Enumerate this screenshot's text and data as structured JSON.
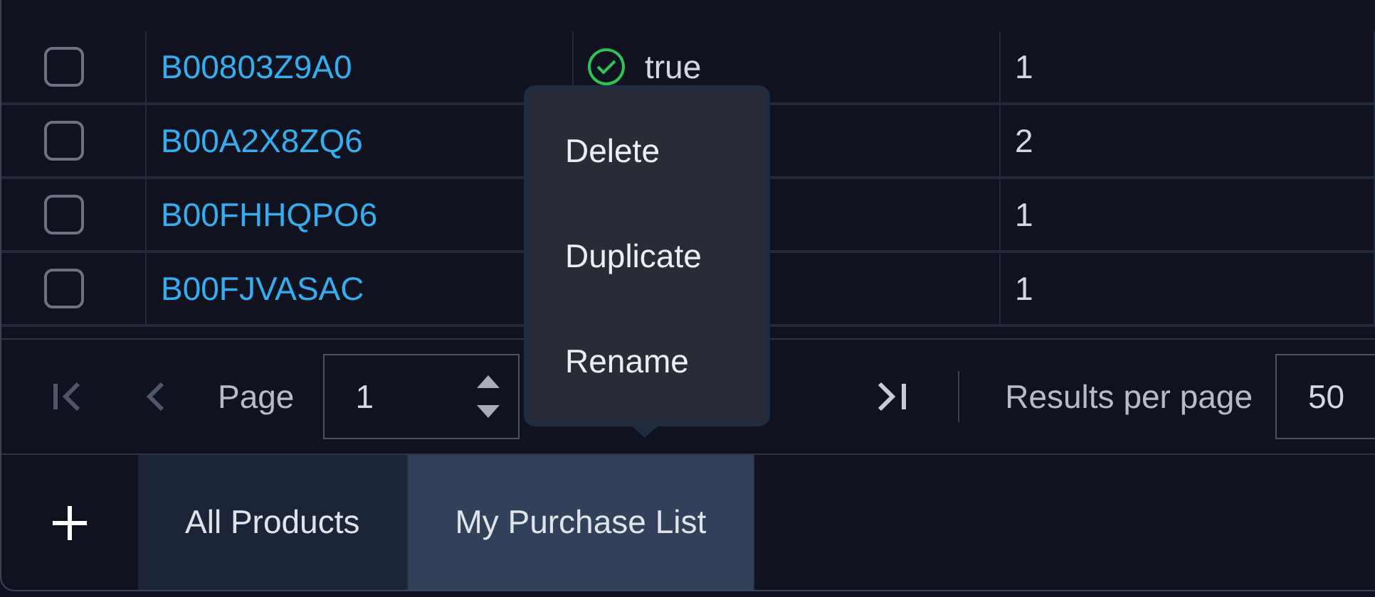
{
  "table": {
    "rows": [
      {
        "checked": false,
        "asin": "B00803Z9A0",
        "status": "true",
        "qty": "1"
      },
      {
        "checked": false,
        "asin": "B00A2X8ZQ6",
        "qty": "2"
      },
      {
        "checked": false,
        "asin": "B00FHHQPO6",
        "qty": "1"
      },
      {
        "checked": false,
        "asin": "B00FJVASAC",
        "qty": "1"
      }
    ]
  },
  "pagination": {
    "first_disabled": true,
    "prev_disabled": true,
    "page_label": "Page",
    "page_value": "1",
    "per_page_label": "Results per page",
    "per_page_value": "50"
  },
  "context_menu": {
    "items": [
      "Delete",
      "Duplicate",
      "Rename"
    ]
  },
  "sheet_tabs": [
    {
      "label": "All Products",
      "selected": false
    },
    {
      "label": "My Purchase List",
      "selected": true
    }
  ]
}
